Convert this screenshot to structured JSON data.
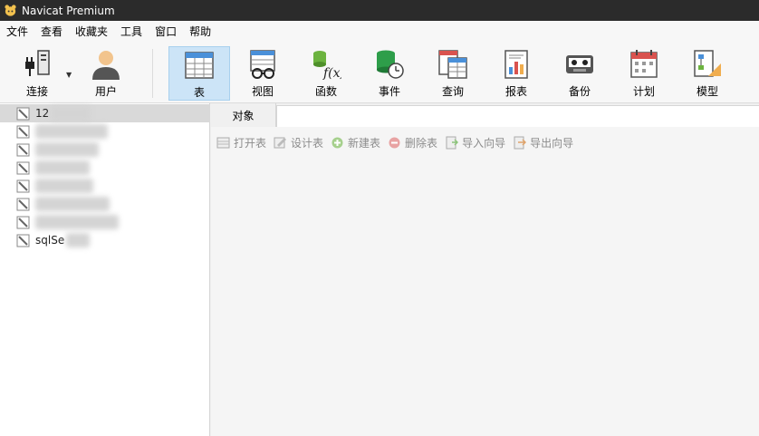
{
  "window": {
    "title": "Navicat Premium"
  },
  "menu": [
    "文件",
    "查看",
    "收藏夹",
    "工具",
    "窗口",
    "帮助"
  ],
  "toolbar": {
    "items": [
      {
        "label": "连接",
        "icon": "plug-icon"
      },
      {
        "label": "用户",
        "icon": "user-icon"
      },
      {
        "label": "表",
        "icon": "table-icon"
      },
      {
        "label": "视图",
        "icon": "view-icon"
      },
      {
        "label": "函数",
        "icon": "function-icon"
      },
      {
        "label": "事件",
        "icon": "event-icon"
      },
      {
        "label": "查询",
        "icon": "query-icon"
      },
      {
        "label": "报表",
        "icon": "report-icon"
      },
      {
        "label": "备份",
        "icon": "backup-icon"
      },
      {
        "label": "计划",
        "icon": "calendar-icon"
      },
      {
        "label": "模型",
        "icon": "model-icon"
      }
    ],
    "active": "表"
  },
  "connections": {
    "items": [
      {
        "label": "12"
      },
      {
        "label": ""
      },
      {
        "label": ""
      },
      {
        "label": ""
      },
      {
        "label": ""
      },
      {
        "label": ""
      },
      {
        "label": ""
      },
      {
        "label": "sqlSe"
      }
    ]
  },
  "tabs": {
    "objects": "对象"
  },
  "object_actions": [
    "打开表",
    "设计表",
    "新建表",
    "删除表",
    "导入向导",
    "导出向导"
  ]
}
